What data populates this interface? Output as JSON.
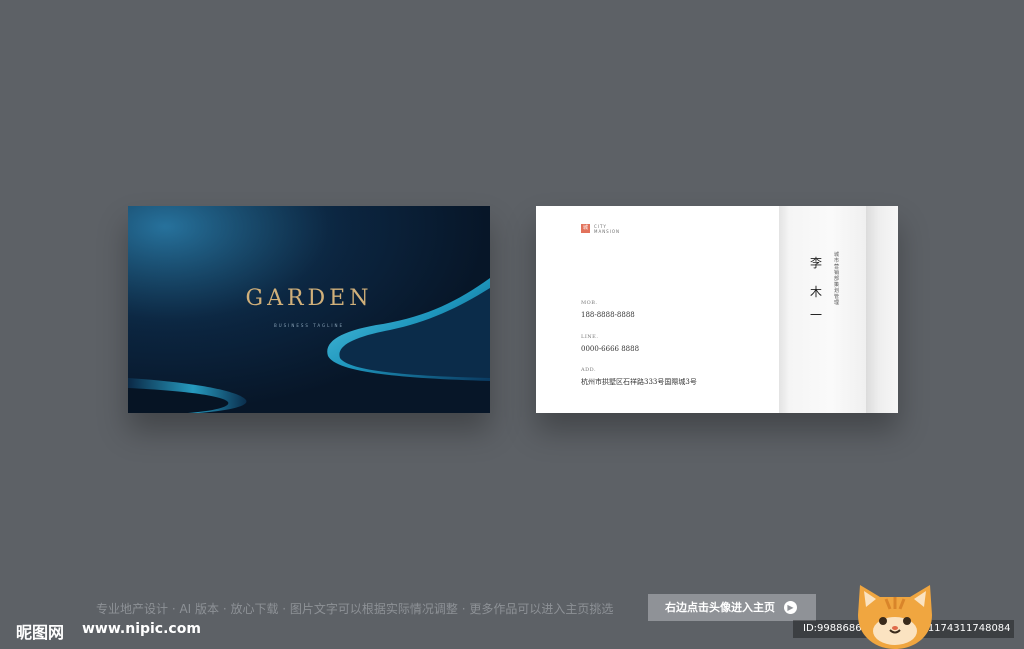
{
  "front_card": {
    "brand": "GARDEN",
    "tagline": "BUSINESS TAGLINE"
  },
  "back_card": {
    "logo_mark": "城",
    "logo_line1": "CITY",
    "logo_line2": "MANSION",
    "mob_label": "MOB.",
    "mob_value": "188-8888-8888",
    "line_label": "LINE.",
    "line_value": "0000-6666 8888",
    "add_label": "ADD.",
    "add_value": "杭州市拱墅区石祥路333号国際城3号",
    "name_chars": [
      "李",
      "木",
      "一"
    ],
    "department": "城市营销部策划管理"
  },
  "watermark": {
    "description": "专业地产设计 · AI 版本 · 放心下载 · 图片文字可以根据实际情况调整 · 更多作品可以进入主页挑选",
    "button_label": "右边点击头像进入主页",
    "site_logo": "昵图网",
    "site_url": "www.nipic.com",
    "id_text": "ID:9988686 NO:20220831174311748084"
  },
  "colors": {
    "background": "#5d6166",
    "front_dark": "#071628",
    "glow": "#2fb3d6",
    "gold": "#d1b07a",
    "logo_red": "#e2725b"
  }
}
